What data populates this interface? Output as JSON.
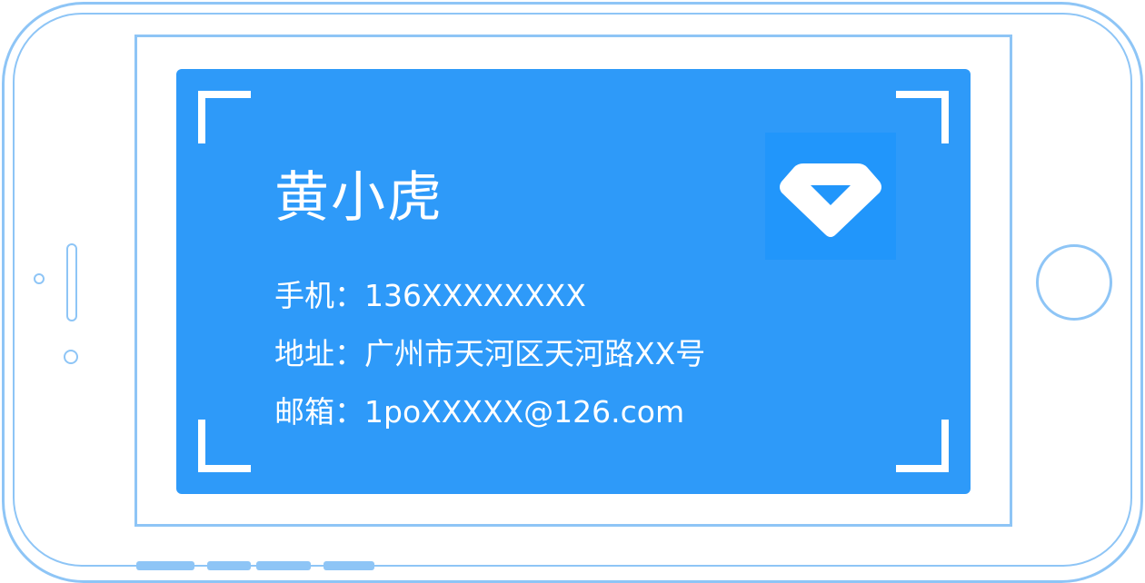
{
  "card": {
    "name": "黄小虎",
    "phone": {
      "label": "手机：",
      "value": "136XXXXXXXX"
    },
    "address": {
      "label": "地址：",
      "value": "广州市天河区天河路XX号"
    },
    "email": {
      "label": "邮箱：",
      "value": "1poXXXXX@126.com"
    }
  },
  "colors": {
    "card_background": "#2e9af9",
    "device_outline": "#8ec5f6",
    "logo_tile": "#2196fb",
    "text": "#ffffff"
  },
  "icons": {
    "logo": "diamond-logo-icon",
    "scan_corners": "scan-frame-corner-icon",
    "home": "home-button-icon"
  }
}
